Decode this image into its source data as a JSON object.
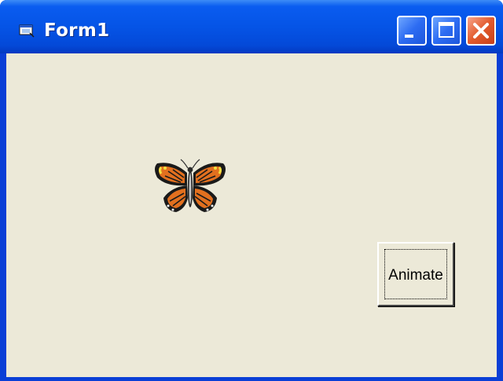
{
  "window": {
    "title": "Form1",
    "icons": {
      "app": "form-icon",
      "minimize": "minimize-icon",
      "maximize": "maximize-icon",
      "close": "close-icon"
    },
    "colors": {
      "titlebar": "#0554e6",
      "client": "#ece9d8",
      "close_button": "#e25a2c"
    }
  },
  "form": {
    "picture": "butterfly-icon",
    "animate_button_label": "Animate"
  }
}
